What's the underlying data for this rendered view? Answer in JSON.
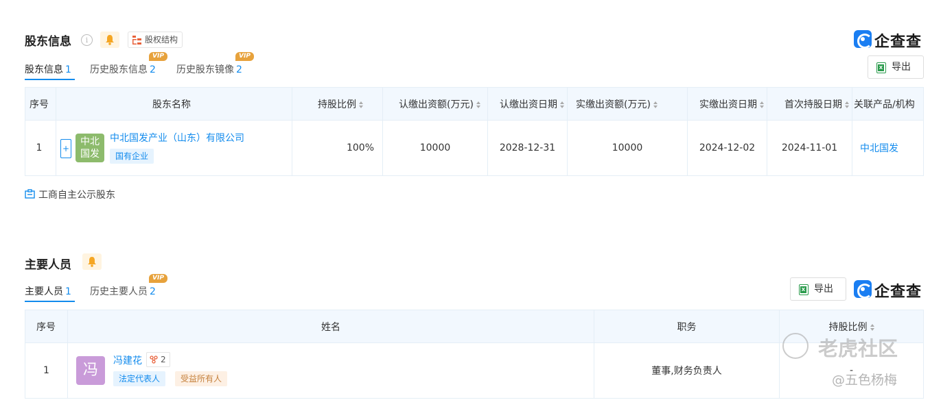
{
  "shareholders": {
    "title": "股东信息",
    "info_icon": "info-icon",
    "equity_button": "股权结构",
    "tabs": [
      {
        "label": "股东信息",
        "count": "1",
        "active": true
      },
      {
        "label": "历史股东信息",
        "count": "2",
        "vip": "VIP"
      },
      {
        "label": "历史股东镜像",
        "count": "2",
        "vip": "VIP"
      }
    ],
    "export_label": "导出",
    "columns": [
      "序号",
      "股东名称",
      "持股比例",
      "认缴出资额(万元)",
      "认缴出资日期",
      "实缴出资额(万元)",
      "实缴出资日期",
      "首次持股日期",
      "关联产品/机构"
    ],
    "rows": [
      {
        "index": "1",
        "expand": "+",
        "logo_text": "中北国发",
        "name": "中北国发产业（山东）有限公司",
        "tag": "国有企业",
        "ratio": "100%",
        "subscribed_amount": "10000",
        "subscribed_date": "2028-12-31",
        "paid_amount": "10000",
        "paid_date": "2024-12-02",
        "first_hold_date": "2024-11-01",
        "related": "中北国发"
      }
    ],
    "public_link": "工商自主公示股东"
  },
  "brand": {
    "name": "企查查"
  },
  "personnel": {
    "title": "主要人员",
    "tabs": [
      {
        "label": "主要人员",
        "count": "1",
        "active": true
      },
      {
        "label": "历史主要人员",
        "count": "2",
        "vip": "VIP"
      }
    ],
    "export_label": "导出",
    "columns": [
      "序号",
      "姓名",
      "职务",
      "持股比例"
    ],
    "rows": [
      {
        "index": "1",
        "avatar_text": "冯",
        "name": "冯建花",
        "relation_count": "2",
        "tags": [
          "法定代表人",
          "受益所有人"
        ],
        "position": "董事,财务负责人",
        "ratio": "-"
      }
    ]
  },
  "watermark": {
    "brand": "老虎社区",
    "author": "@五色杨梅"
  },
  "colors": {
    "accent": "#128bed",
    "header_bg": "#f2f8fe",
    "vip": "#e7a23c"
  }
}
